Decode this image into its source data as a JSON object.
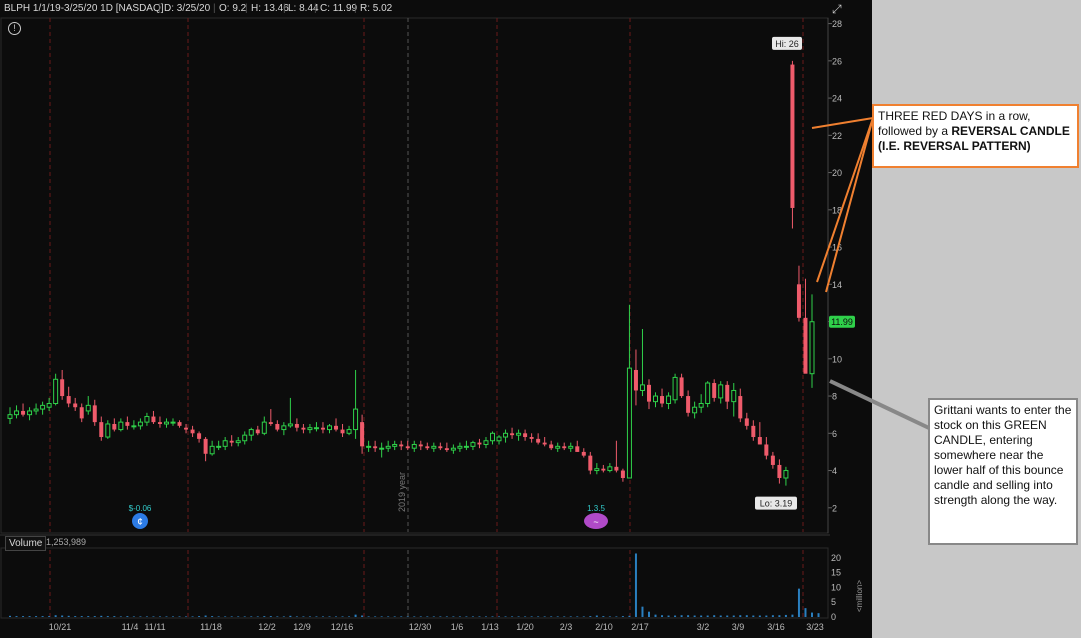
{
  "header": {
    "symbol": "BLPH 1/1/19-3/25/20 1D [NASDAQ]",
    "date": "D: 3/25/20",
    "open": "O: 9.2",
    "high": "H: 13.46",
    "low": "L: 8.44",
    "close": "C: 11.99",
    "range": "R: 5.02"
  },
  "volume": {
    "label": "Volume",
    "value": "1,253,989",
    "unit": "<million>"
  },
  "colors": {
    "up": "#2fd14a",
    "down": "#ef5b6b",
    "price_tag": "#2fd14a",
    "annotation_red": "#f08030",
    "annotation_gray": "#888888"
  },
  "chart_data": {
    "type": "candlestick",
    "y_ticks": [
      2,
      4,
      6,
      8,
      10,
      12,
      14,
      16,
      18,
      20,
      22,
      24,
      26,
      28
    ],
    "ylim": [
      0.7,
      28.3
    ],
    "volume_ticks": [
      0,
      5,
      10,
      15,
      20
    ],
    "x_tick_labels": [
      "10/21",
      "11/4",
      "11/11",
      "11/18",
      "12/2",
      "12/9",
      "12/16",
      "12/30",
      "1/6",
      "1/13",
      "1/20",
      "2/3",
      "2/10",
      "2/17",
      "3/2",
      "3/9",
      "3/16",
      "3/23"
    ],
    "hi_label": "Hi: 26",
    "lo_label": "Lo: 3.19",
    "last_price": "11.99",
    "year_marker": "2019 year",
    "event_labels": [
      "$-0.06",
      "1.3.5"
    ],
    "candles": [
      {
        "o": 6.8,
        "h": 7.4,
        "l": 6.5,
        "c": 7.0
      },
      {
        "o": 7.0,
        "h": 7.5,
        "l": 6.8,
        "c": 7.2
      },
      {
        "o": 7.2,
        "h": 7.6,
        "l": 6.9,
        "c": 7.0
      },
      {
        "o": 7.0,
        "h": 7.4,
        "l": 6.7,
        "c": 7.2
      },
      {
        "o": 7.2,
        "h": 7.6,
        "l": 7.0,
        "c": 7.3
      },
      {
        "o": 7.3,
        "h": 7.7,
        "l": 7.0,
        "c": 7.5
      },
      {
        "o": 7.4,
        "h": 7.9,
        "l": 7.2,
        "c": 7.6
      },
      {
        "o": 7.6,
        "h": 9.2,
        "l": 7.5,
        "c": 8.9
      },
      {
        "o": 8.9,
        "h": 9.4,
        "l": 7.8,
        "c": 8.0
      },
      {
        "o": 8.0,
        "h": 8.5,
        "l": 7.4,
        "c": 7.6
      },
      {
        "o": 7.6,
        "h": 7.9,
        "l": 7.2,
        "c": 7.4
      },
      {
        "o": 7.4,
        "h": 7.6,
        "l": 6.6,
        "c": 6.8
      },
      {
        "o": 7.2,
        "h": 8.0,
        "l": 7.0,
        "c": 7.5
      },
      {
        "o": 7.5,
        "h": 7.8,
        "l": 6.4,
        "c": 6.6
      },
      {
        "o": 6.6,
        "h": 6.9,
        "l": 5.6,
        "c": 5.8
      },
      {
        "o": 5.8,
        "h": 6.7,
        "l": 5.7,
        "c": 6.5
      },
      {
        "o": 6.5,
        "h": 6.8,
        "l": 6.1,
        "c": 6.2
      },
      {
        "o": 6.2,
        "h": 6.8,
        "l": 6.1,
        "c": 6.6
      },
      {
        "o": 6.6,
        "h": 6.9,
        "l": 6.2,
        "c": 6.4
      },
      {
        "o": 6.4,
        "h": 6.7,
        "l": 6.2,
        "c": 6.4
      },
      {
        "o": 6.4,
        "h": 6.8,
        "l": 6.2,
        "c": 6.6
      },
      {
        "o": 6.6,
        "h": 7.1,
        "l": 6.4,
        "c": 6.9
      },
      {
        "o": 6.9,
        "h": 7.2,
        "l": 6.5,
        "c": 6.6
      },
      {
        "o": 6.6,
        "h": 6.9,
        "l": 6.3,
        "c": 6.5
      },
      {
        "o": 6.5,
        "h": 6.8,
        "l": 6.3,
        "c": 6.6
      },
      {
        "o": 6.6,
        "h": 6.8,
        "l": 6.4,
        "c": 6.6
      },
      {
        "o": 6.6,
        "h": 6.7,
        "l": 6.3,
        "c": 6.4
      },
      {
        "o": 6.3,
        "h": 6.5,
        "l": 6.0,
        "c": 6.2
      },
      {
        "o": 6.2,
        "h": 6.4,
        "l": 5.8,
        "c": 6.0
      },
      {
        "o": 6.0,
        "h": 6.1,
        "l": 5.5,
        "c": 5.7
      },
      {
        "o": 5.7,
        "h": 5.8,
        "l": 4.5,
        "c": 4.9
      },
      {
        "o": 4.9,
        "h": 5.6,
        "l": 4.8,
        "c": 5.3
      },
      {
        "o": 5.3,
        "h": 5.6,
        "l": 5.1,
        "c": 5.3
      },
      {
        "o": 5.3,
        "h": 5.8,
        "l": 5.1,
        "c": 5.6
      },
      {
        "o": 5.6,
        "h": 5.9,
        "l": 5.3,
        "c": 5.5
      },
      {
        "o": 5.5,
        "h": 5.8,
        "l": 5.3,
        "c": 5.6
      },
      {
        "o": 5.6,
        "h": 6.1,
        "l": 5.4,
        "c": 5.9
      },
      {
        "o": 5.9,
        "h": 6.3,
        "l": 5.6,
        "c": 6.2
      },
      {
        "o": 6.2,
        "h": 6.4,
        "l": 5.9,
        "c": 6.0
      },
      {
        "o": 6.0,
        "h": 6.9,
        "l": 5.9,
        "c": 6.6
      },
      {
        "o": 6.6,
        "h": 7.3,
        "l": 6.4,
        "c": 6.5
      },
      {
        "o": 6.5,
        "h": 6.7,
        "l": 6.1,
        "c": 6.2
      },
      {
        "o": 6.2,
        "h": 6.6,
        "l": 5.9,
        "c": 6.4
      },
      {
        "o": 6.4,
        "h": 7.9,
        "l": 6.3,
        "c": 6.5
      },
      {
        "o": 6.5,
        "h": 6.8,
        "l": 6.1,
        "c": 6.3
      },
      {
        "o": 6.3,
        "h": 6.5,
        "l": 6.0,
        "c": 6.2
      },
      {
        "o": 6.2,
        "h": 6.5,
        "l": 6.0,
        "c": 6.3
      },
      {
        "o": 6.3,
        "h": 6.6,
        "l": 6.1,
        "c": 6.3
      },
      {
        "o": 6.3,
        "h": 6.6,
        "l": 6.0,
        "c": 6.2
      },
      {
        "o": 6.2,
        "h": 6.5,
        "l": 6.0,
        "c": 6.4
      },
      {
        "o": 6.4,
        "h": 6.8,
        "l": 6.1,
        "c": 6.2
      },
      {
        "o": 6.2,
        "h": 6.5,
        "l": 5.8,
        "c": 6.0
      },
      {
        "o": 6.0,
        "h": 6.4,
        "l": 5.9,
        "c": 6.2
      },
      {
        "o": 6.2,
        "h": 9.4,
        "l": 5.7,
        "c": 7.3
      },
      {
        "o": 6.6,
        "h": 7.0,
        "l": 4.9,
        "c": 5.3
      },
      {
        "o": 5.3,
        "h": 5.6,
        "l": 5.0,
        "c": 5.3
      },
      {
        "o": 5.3,
        "h": 5.6,
        "l": 5.0,
        "c": 5.2
      },
      {
        "o": 5.2,
        "h": 5.5,
        "l": 4.7,
        "c": 5.2
      },
      {
        "o": 5.2,
        "h": 5.6,
        "l": 5.0,
        "c": 5.3
      },
      {
        "o": 5.3,
        "h": 5.6,
        "l": 5.1,
        "c": 5.4
      },
      {
        "o": 5.4,
        "h": 5.6,
        "l": 5.1,
        "c": 5.3
      },
      {
        "o": 5.3,
        "h": 5.6,
        "l": 5.1,
        "c": 5.2
      },
      {
        "o": 5.2,
        "h": 5.6,
        "l": 5.0,
        "c": 5.4
      },
      {
        "o": 5.4,
        "h": 5.6,
        "l": 5.1,
        "c": 5.3
      },
      {
        "o": 5.3,
        "h": 5.5,
        "l": 5.1,
        "c": 5.2
      },
      {
        "o": 5.2,
        "h": 5.5,
        "l": 5.0,
        "c": 5.3
      },
      {
        "o": 5.3,
        "h": 5.5,
        "l": 5.1,
        "c": 5.2
      },
      {
        "o": 5.2,
        "h": 5.5,
        "l": 5.0,
        "c": 5.1
      },
      {
        "o": 5.1,
        "h": 5.4,
        "l": 4.9,
        "c": 5.2
      },
      {
        "o": 5.2,
        "h": 5.5,
        "l": 5.0,
        "c": 5.3
      },
      {
        "o": 5.3,
        "h": 5.6,
        "l": 5.1,
        "c": 5.3
      },
      {
        "o": 5.3,
        "h": 5.6,
        "l": 5.1,
        "c": 5.5
      },
      {
        "o": 5.5,
        "h": 5.7,
        "l": 5.2,
        "c": 5.4
      },
      {
        "o": 5.4,
        "h": 5.8,
        "l": 5.2,
        "c": 5.6
      },
      {
        "o": 5.6,
        "h": 6.1,
        "l": 5.4,
        "c": 6.0
      },
      {
        "o": 5.6,
        "h": 5.9,
        "l": 5.4,
        "c": 5.8
      },
      {
        "o": 5.8,
        "h": 6.2,
        "l": 5.5,
        "c": 6.0
      },
      {
        "o": 6.0,
        "h": 6.3,
        "l": 5.7,
        "c": 5.9
      },
      {
        "o": 5.9,
        "h": 6.2,
        "l": 5.6,
        "c": 6.0
      },
      {
        "o": 6.0,
        "h": 6.2,
        "l": 5.6,
        "c": 5.8
      },
      {
        "o": 5.8,
        "h": 6.0,
        "l": 5.5,
        "c": 5.7
      },
      {
        "o": 5.7,
        "h": 6.0,
        "l": 5.4,
        "c": 5.5
      },
      {
        "o": 5.5,
        "h": 5.8,
        "l": 5.3,
        "c": 5.4
      },
      {
        "o": 5.4,
        "h": 5.6,
        "l": 5.1,
        "c": 5.2
      },
      {
        "o": 5.2,
        "h": 5.5,
        "l": 5.0,
        "c": 5.3
      },
      {
        "o": 5.3,
        "h": 5.5,
        "l": 5.1,
        "c": 5.2
      },
      {
        "o": 5.2,
        "h": 5.5,
        "l": 5.0,
        "c": 5.3
      },
      {
        "o": 5.3,
        "h": 5.6,
        "l": 5.0,
        "c": 5.0
      },
      {
        "o": 5.0,
        "h": 5.2,
        "l": 4.7,
        "c": 4.8
      },
      {
        "o": 4.8,
        "h": 5.0,
        "l": 3.8,
        "c": 4.0
      },
      {
        "o": 4.0,
        "h": 4.4,
        "l": 3.8,
        "c": 4.1
      },
      {
        "o": 4.1,
        "h": 4.3,
        "l": 3.9,
        "c": 4.0
      },
      {
        "o": 4.0,
        "h": 4.4,
        "l": 3.9,
        "c": 4.2
      },
      {
        "o": 4.2,
        "h": 5.6,
        "l": 3.9,
        "c": 4.0
      },
      {
        "o": 4.0,
        "h": 4.1,
        "l": 3.4,
        "c": 3.6
      },
      {
        "o": 3.6,
        "h": 12.9,
        "l": 5.4,
        "c": 9.5
      },
      {
        "o": 9.4,
        "h": 10.5,
        "l": 7.5,
        "c": 8.3
      },
      {
        "o": 8.3,
        "h": 11.6,
        "l": 8.0,
        "c": 8.6
      },
      {
        "o": 8.6,
        "h": 8.9,
        "l": 7.3,
        "c": 7.7
      },
      {
        "o": 7.7,
        "h": 8.2,
        "l": 7.4,
        "c": 8.0
      },
      {
        "o": 8.0,
        "h": 8.4,
        "l": 7.4,
        "c": 7.6
      },
      {
        "o": 7.6,
        "h": 8.2,
        "l": 7.3,
        "c": 8.0
      },
      {
        "o": 7.8,
        "h": 9.2,
        "l": 7.6,
        "c": 9.0
      },
      {
        "o": 9.0,
        "h": 9.2,
        "l": 7.9,
        "c": 8.0
      },
      {
        "o": 8.0,
        "h": 8.3,
        "l": 6.9,
        "c": 7.1
      },
      {
        "o": 7.1,
        "h": 7.7,
        "l": 6.8,
        "c": 7.4
      },
      {
        "o": 7.4,
        "h": 8.1,
        "l": 7.1,
        "c": 7.6
      },
      {
        "o": 7.6,
        "h": 8.8,
        "l": 7.4,
        "c": 8.7
      },
      {
        "o": 8.7,
        "h": 8.9,
        "l": 7.7,
        "c": 7.9
      },
      {
        "o": 7.9,
        "h": 8.8,
        "l": 7.6,
        "c": 8.6
      },
      {
        "o": 8.6,
        "h": 8.8,
        "l": 7.3,
        "c": 7.7
      },
      {
        "o": 7.7,
        "h": 8.7,
        "l": 6.9,
        "c": 8.3
      },
      {
        "o": 8.0,
        "h": 8.4,
        "l": 6.6,
        "c": 6.8
      },
      {
        "o": 6.8,
        "h": 7.1,
        "l": 6.2,
        "c": 6.4
      },
      {
        "o": 6.4,
        "h": 6.7,
        "l": 5.6,
        "c": 5.8
      },
      {
        "o": 5.8,
        "h": 6.6,
        "l": 5.4,
        "c": 5.4
      },
      {
        "o": 5.4,
        "h": 5.8,
        "l": 4.6,
        "c": 4.8
      },
      {
        "o": 4.8,
        "h": 5.0,
        "l": 4.1,
        "c": 4.3
      },
      {
        "o": 4.3,
        "h": 4.6,
        "l": 3.3,
        "c": 3.6
      },
      {
        "o": 3.6,
        "h": 4.2,
        "l": 3.19,
        "c": 4.0
      },
      {
        "o": 25.8,
        "h": 26.0,
        "l": 17.0,
        "c": 18.1
      },
      {
        "o": 14.0,
        "h": 15.0,
        "l": 12.0,
        "c": 12.2
      },
      {
        "o": 12.2,
        "h": 14.3,
        "l": 9.3,
        "c": 9.2
      },
      {
        "o": 9.2,
        "h": 13.46,
        "l": 8.44,
        "c": 11.99
      }
    ],
    "volume": [
      0.4,
      0.3,
      0.3,
      0.3,
      0.3,
      0.3,
      0.3,
      0.6,
      0.5,
      0.4,
      0.3,
      0.3,
      0.3,
      0.3,
      0.4,
      0.3,
      0.3,
      0.2,
      0.3,
      0.2,
      0.2,
      0.2,
      0.2,
      0.2,
      0.2,
      0.2,
      0.2,
      0.2,
      0.2,
      0.3,
      0.5,
      0.3,
      0.2,
      0.2,
      0.2,
      0.2,
      0.2,
      0.2,
      0.2,
      0.3,
      0.3,
      0.2,
      0.2,
      0.4,
      0.2,
      0.2,
      0.2,
      0.2,
      0.2,
      0.2,
      0.2,
      0.2,
      0.2,
      0.8,
      0.5,
      0.2,
      0.2,
      0.2,
      0.2,
      0.2,
      0.2,
      0.2,
      0.2,
      0.2,
      0.2,
      0.2,
      0.2,
      0.2,
      0.2,
      0.2,
      0.2,
      0.2,
      0.2,
      0.2,
      0.2,
      0.2,
      0.2,
      0.2,
      0.2,
      0.2,
      0.2,
      0.2,
      0.2,
      0.2,
      0.2,
      0.2,
      0.2,
      0.2,
      0.2,
      0.3,
      0.5,
      0.3,
      0.2,
      0.2,
      0.3,
      0.4,
      21.5,
      3.5,
      1.8,
      0.8,
      0.6,
      0.5,
      0.5,
      0.6,
      0.6,
      0.5,
      0.5,
      0.5,
      0.6,
      0.5,
      0.5,
      0.5,
      0.6,
      0.6,
      0.5,
      0.5,
      0.5,
      0.6,
      0.6,
      0.7,
      0.8,
      9.6,
      3.0,
      1.5,
      1.3
    ]
  },
  "annotations": {
    "red_note": {
      "line1": "THREE RED DAYS in a row,",
      "line2_pre": "followed by a ",
      "line2_bold": "REVERSAL CANDLE",
      "line3_bold": "(I.E. REVERSAL PATTERN)"
    },
    "green_note": "Grittani wants to enter the stock on this GREEN CANDLE, entering somewhere near the lower half of this bounce candle and selling into strength along the way."
  }
}
